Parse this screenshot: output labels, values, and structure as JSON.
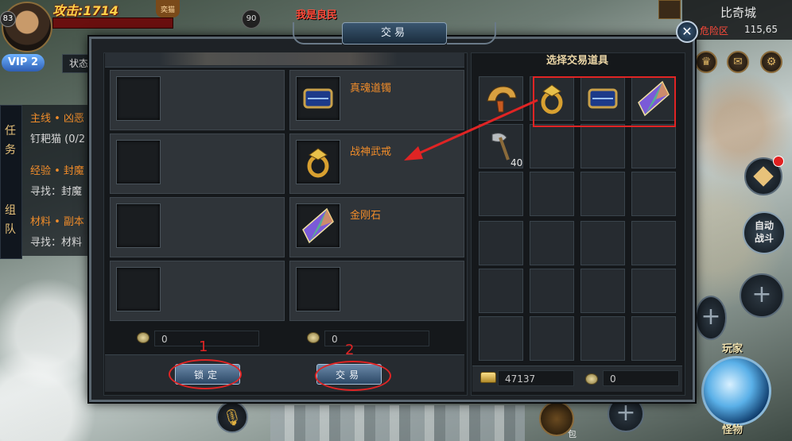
{
  "hud": {
    "player_level": "83",
    "attack_text": "攻击:1714",
    "top_badge": "奕猫",
    "vip_label": "VIP 2",
    "status_label": "状态",
    "target_level": "90",
    "target_name": "我是良民"
  },
  "map": {
    "name": "比奇城",
    "zone": "危险区",
    "coords": "115,65"
  },
  "quests": {
    "tabs": [
      "任",
      "务",
      "组",
      "队"
    ],
    "lines": [
      {
        "text": "主线 • 凶恶",
        "style": "orange"
      },
      {
        "text": "钉耙猫 (0/2",
        "style": "white"
      },
      {
        "text": "经验 • 封魔",
        "style": "orange"
      },
      {
        "text": "寻找：封魔",
        "style": "white"
      },
      {
        "text": "材料 • 副本",
        "style": "orange"
      },
      {
        "text": "寻找：材料",
        "style": "white"
      }
    ]
  },
  "controls": {
    "auto_fight_line1": "自动",
    "auto_fight_line2": "战斗",
    "player_label": "玩家",
    "monster_label": "怪物",
    "bag_label": "包"
  },
  "dialog": {
    "title": "交易",
    "close_icon": "close-icon",
    "offered_items": [
      {
        "name": "真魂道镯",
        "icon": "bracelet-icon"
      },
      {
        "name": "战神武戒",
        "icon": "ring-icon"
      },
      {
        "name": "金刚石",
        "icon": "diamond-icon"
      },
      {
        "name": "",
        "icon": ""
      }
    ],
    "other_coin_value": "0",
    "my_coin_value": "0",
    "lock_button": "锁定",
    "trade_button": "交易",
    "annotation_1": "1",
    "annotation_2": "2",
    "inventory": {
      "title": "选择交易道具",
      "items": [
        {
          "icon": "helmet-icon",
          "count": ""
        },
        {
          "icon": "ring-icon",
          "count": ""
        },
        {
          "icon": "bracelet-icon",
          "count": ""
        },
        {
          "icon": "diamond-icon",
          "count": ""
        },
        {
          "icon": "axe-icon",
          "count": "40"
        }
      ],
      "gold_value": "47137",
      "coin_value": "0"
    }
  },
  "colors": {
    "item_name": "#f08c2a",
    "annotation_red": "#e02424",
    "panel_bg": "#1e2226"
  }
}
